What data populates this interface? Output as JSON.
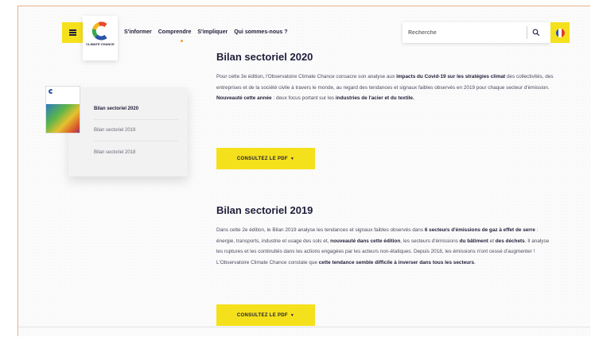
{
  "header": {
    "nav": [
      "S'informer",
      "Comprendre",
      "S'impliquer",
      "Qui sommes-nous ?"
    ],
    "search_placeholder": "Recherche",
    "logo_text": "CLIMATE CHANCE"
  },
  "sidebar": {
    "items": [
      {
        "label": "Bilan sectoriel 2020",
        "active": true
      },
      {
        "label": "Bilan sectoriel 2019",
        "active": false
      },
      {
        "label": "Bilan sectoriel 2018",
        "active": false
      }
    ]
  },
  "sections": [
    {
      "title": "Bilan sectoriel 2020",
      "paragraph": [
        {
          "t": "Pour cette 3e édition, l'Observatoire Climate Chance consacre son analyse aux ",
          "b": false
        },
        {
          "t": "impacts du Covid-19 sur les stratégies climat",
          "b": true
        },
        {
          "t": " des collectivités, des entreprises et de la société civile à travers le monde, au regard des tendances et signaux faibles observés en 2019 pour chaque secteur d'émission. ",
          "b": false
        },
        {
          "t": "Nouveauté cette année",
          "b": true
        },
        {
          "t": " : deux focus portant sur les ",
          "b": false
        },
        {
          "t": "industries de l'acier et du textile.",
          "b": true
        }
      ],
      "cta": "CONSULTEZ LE PDF"
    },
    {
      "title": "Bilan sectoriel 2019",
      "paragraph": [
        {
          "t": "Dans cette 2e édition, le Bilan 2019 analyse les tendances et signaux faibles observés dans ",
          "b": false
        },
        {
          "t": "6 secteurs d'émissions de gaz à effet de serre",
          "b": true
        },
        {
          "t": " : énergie, transports, industrie et usage des sols et, ",
          "b": false
        },
        {
          "t": "nouveauté dans cette édition",
          "b": true
        },
        {
          "t": ", les secteurs d'émissions ",
          "b": false
        },
        {
          "t": "du bâtiment",
          "b": true
        },
        {
          "t": " et ",
          "b": false
        },
        {
          "t": "des déchets",
          "b": true
        },
        {
          "t": ". Il analyse les ruptures et les continuités dans les actions engagées par les acteurs non-étatiques. Depuis 2018, les émissions n'ont cessé d'augmenter ! L'Observatoire Climate Chance constate que ",
          "b": false
        },
        {
          "t": "cette tendance semble difficile à inverser dans tous les secteurs",
          "b": true
        },
        {
          "t": ".",
          "b": false
        }
      ],
      "cta": "CONSULTEZ LE PDF"
    }
  ],
  "colors": {
    "accent": "#f5e01c",
    "text": "#1e1e3a",
    "frame": "#e8b08a"
  },
  "icons": [
    "menu-icon",
    "search-icon",
    "french-flag-icon",
    "chevron-down-icon",
    "climate-chance-logo"
  ]
}
